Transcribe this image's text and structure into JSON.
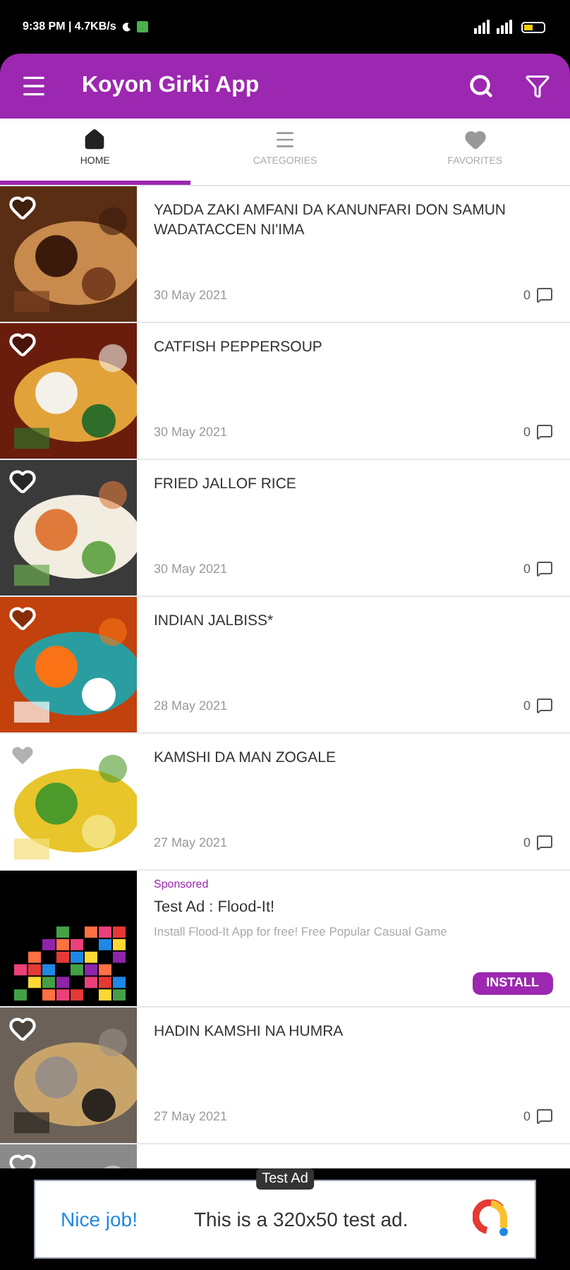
{
  "status_bar": {
    "time": "9:38 PM | 4.7KB/s"
  },
  "app_bar": {
    "title": "Koyon Girki App"
  },
  "tabs": [
    {
      "label": "HOME",
      "selected": true
    },
    {
      "label": "CATEGORIES",
      "selected": false
    },
    {
      "label": "FAVORITES",
      "selected": false
    }
  ],
  "feed": [
    {
      "kind": "recipe",
      "title": "YADDA ZAKI AMFANI DA KANUNFARI DON SAMUN WADATACCEN NI'IMA",
      "date": "30 May 2021",
      "comments": "0"
    },
    {
      "kind": "recipe",
      "title": "CATFISH PEPPERSOUP",
      "date": "30 May 2021",
      "comments": "0"
    },
    {
      "kind": "recipe",
      "title": "FRIED JALLOF RICE",
      "date": "30 May 2021",
      "comments": "0"
    },
    {
      "kind": "recipe",
      "title": "INDIAN JALBISS*",
      "date": "28 May 2021",
      "comments": "0"
    },
    {
      "kind": "recipe",
      "title": "KAMSHI DA MAN ZOGALE",
      "date": "27 May 2021",
      "comments": "0"
    },
    {
      "kind": "ad",
      "label": "Sponsored",
      "title": "Test Ad : Flood-It!",
      "description": "Install Flood-It App for free! Free Popular Casual Game",
      "button": "INSTALL"
    },
    {
      "kind": "recipe",
      "title": "HADIN KAMSHI NA HUMRA",
      "date": "27 May 2021",
      "comments": "0"
    },
    {
      "kind": "partial"
    }
  ],
  "banner_ad": {
    "tag": "Test Ad",
    "headline": "Nice job!",
    "text": "This is a 320x50 test ad."
  }
}
